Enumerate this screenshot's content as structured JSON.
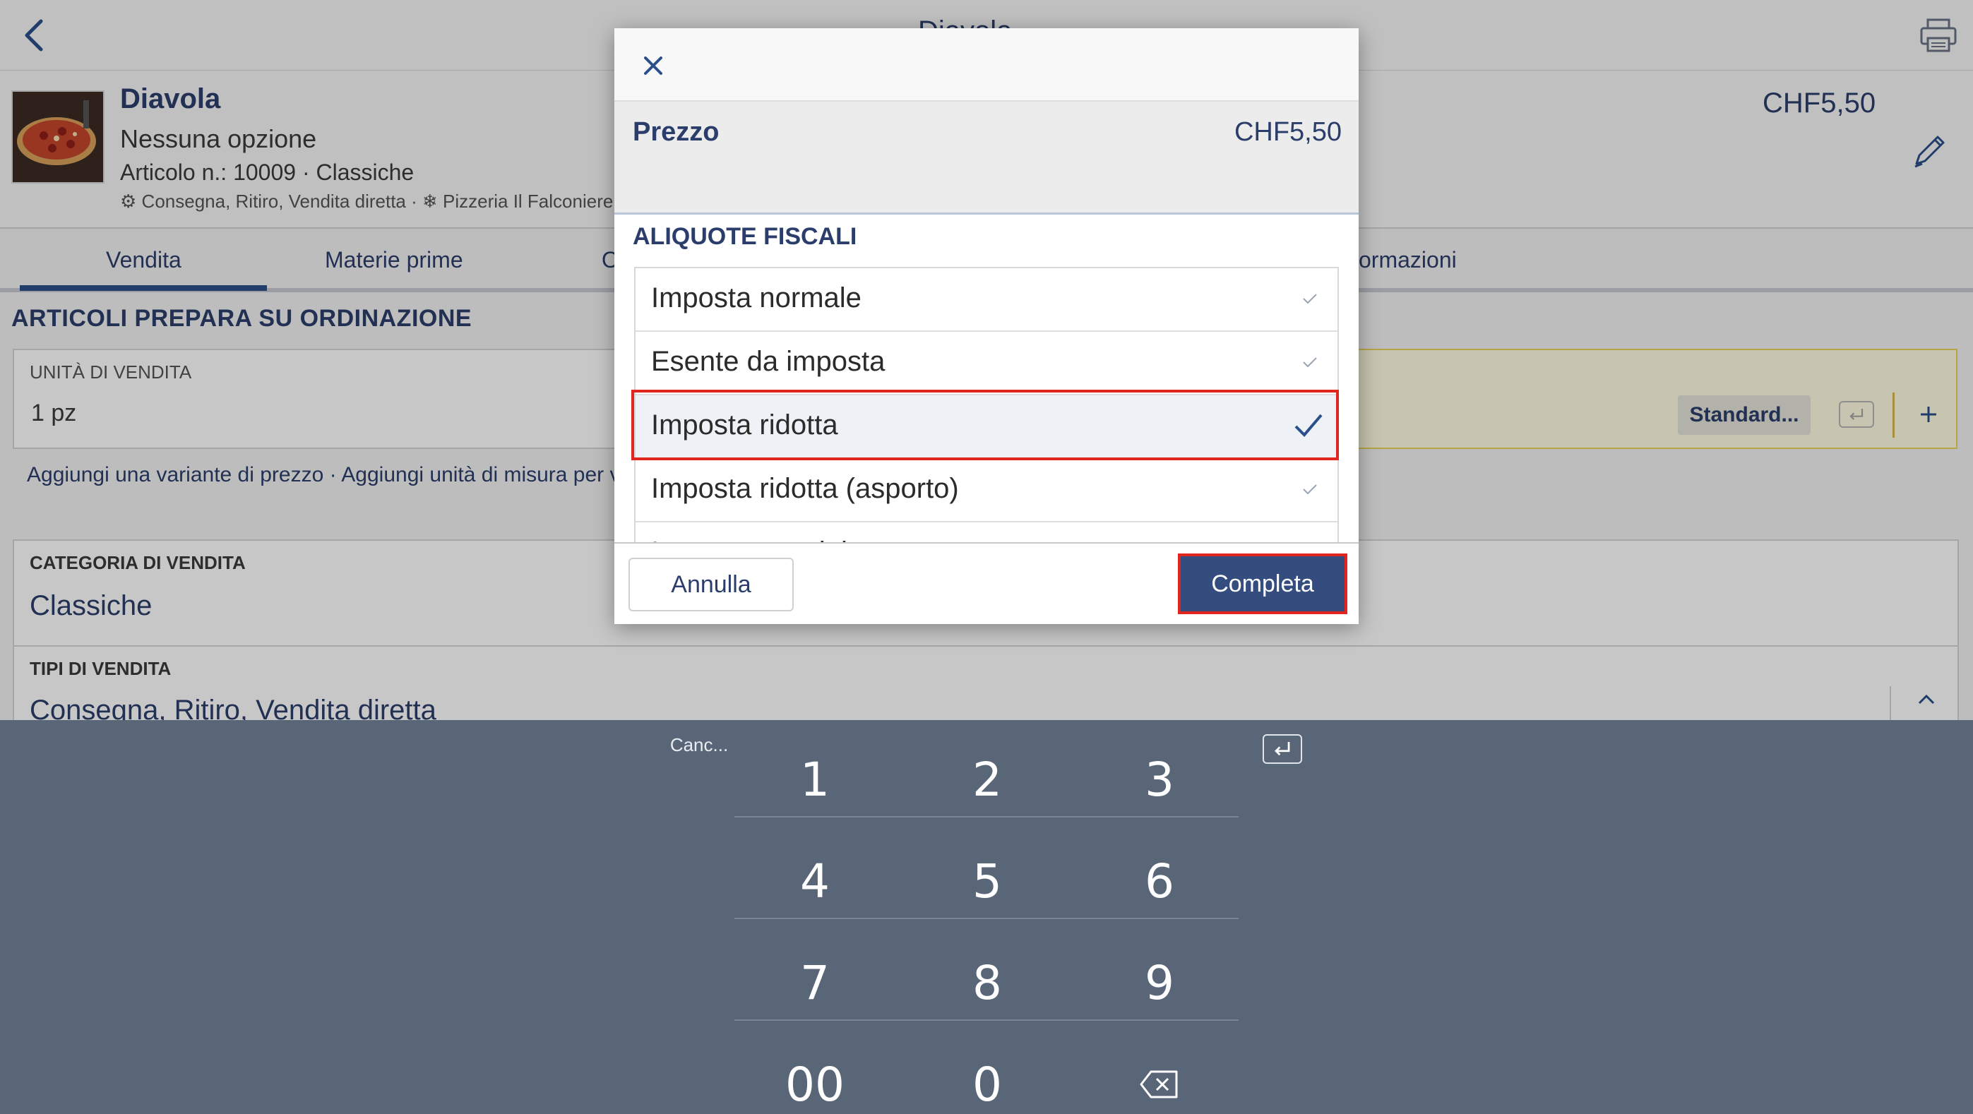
{
  "topbar": {
    "title": "Diavola"
  },
  "item": {
    "name": "Diavola",
    "option": "Nessuna opzione",
    "article": "Articolo n.: 10009 · Classiche",
    "meta": "Consegna, Ritiro, Vendita diretta · ❄ Pizzeria Il Falconiere",
    "price": "CHF5,50"
  },
  "tabs": [
    {
      "label": "Vendita"
    },
    {
      "label": "Materie prime"
    },
    {
      "label": "O"
    },
    {
      "label": "ormazioni"
    }
  ],
  "sales": {
    "heading": "ARTICOLI PREPARA SU ORDINAZIONE",
    "unit_label": "UNITÀ DI VENDITA",
    "unit_value": "1 pz",
    "standard_label": "Standard...",
    "links": "Aggiungi una variante di prezzo · Aggiungi unità di misura per v",
    "category_label": "CATEGORIA DI VENDITA",
    "category_value": "Classiche",
    "types_label": "TIPI DI VENDITA",
    "types_value": "Consegna, Ritiro, Vendita diretta"
  },
  "modal": {
    "price_label": "Prezzo",
    "price_value": "CHF5,50",
    "tax_heading": "ALIQUOTE FISCALI",
    "tax_rates": [
      {
        "label": "Imposta normale",
        "selected": false
      },
      {
        "label": "Esente da imposta",
        "selected": false
      },
      {
        "label": "Imposta ridotta",
        "selected": true
      },
      {
        "label": "Imposta ridotta (asporto)",
        "selected": false
      },
      {
        "label": "Imposta speciale",
        "selected": false
      }
    ],
    "cancel_label": "Annulla",
    "complete_label": "Completa"
  },
  "keypad": {
    "clear_label": "Canc...",
    "keys": [
      "1",
      "2",
      "3",
      "4",
      "5",
      "6",
      "7",
      "8",
      "9",
      "00",
      "0"
    ]
  },
  "colors": {
    "brand": "#2b3e6b",
    "keypad_bg": "#596678",
    "primary_button": "#344d7e",
    "highlight_outline": "#e0261e"
  }
}
